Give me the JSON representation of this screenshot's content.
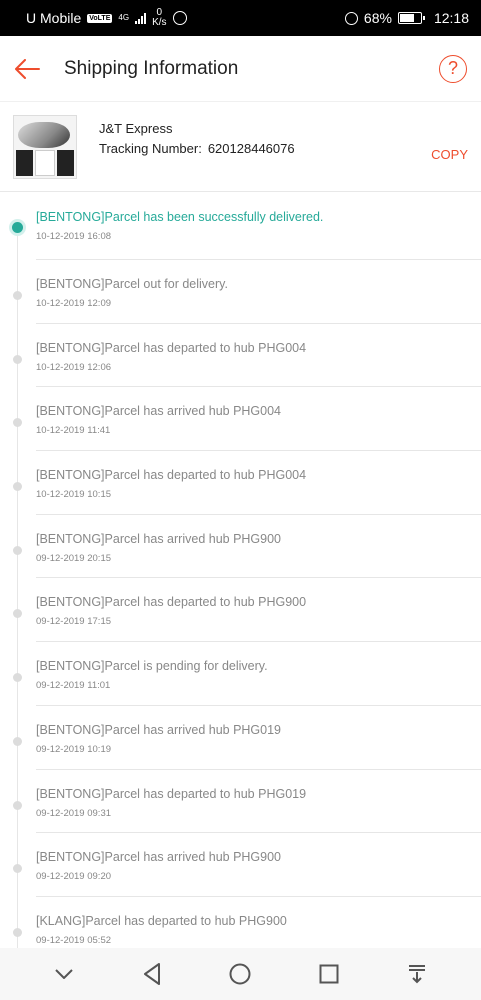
{
  "status_bar": {
    "carrier": "U Mobile",
    "volte": "VoLTE",
    "network": "4G",
    "speed_value": "0",
    "speed_unit": "K/s",
    "battery": "68%",
    "time": "12:18"
  },
  "header": {
    "title": "Shipping Information"
  },
  "carrier": {
    "name": "J&T Express",
    "tracking_label": "Tracking Number:",
    "tracking_number": "620128446076",
    "copy_label": "COPY"
  },
  "events": [
    {
      "text": "[BENTONG]Parcel has been successfully delivered.",
      "time": "10-12-2019 16:08"
    },
    {
      "text": "[BENTONG]Parcel out for delivery.",
      "time": "10-12-2019 12:09"
    },
    {
      "text": "[BENTONG]Parcel has departed to hub PHG004",
      "time": "10-12-2019 12:06"
    },
    {
      "text": "[BENTONG]Parcel has arrived hub PHG004",
      "time": "10-12-2019 11:41"
    },
    {
      "text": "[BENTONG]Parcel has departed to hub PHG004",
      "time": "10-12-2019 10:15"
    },
    {
      "text": "[BENTONG]Parcel has arrived hub PHG900",
      "time": "09-12-2019 20:15"
    },
    {
      "text": "[BENTONG]Parcel has departed to hub PHG900",
      "time": "09-12-2019 17:15"
    },
    {
      "text": "[BENTONG]Parcel is pending for delivery.",
      "time": "09-12-2019 11:01"
    },
    {
      "text": "[BENTONG]Parcel has arrived hub PHG019",
      "time": "09-12-2019 10:19"
    },
    {
      "text": "[BENTONG]Parcel has departed to hub PHG019",
      "time": "09-12-2019 09:31"
    },
    {
      "text": "[BENTONG]Parcel has arrived hub PHG900",
      "time": "09-12-2019 09:20"
    },
    {
      "text": "[KLANG]Parcel has departed to hub PHG900",
      "time": "09-12-2019 05:52"
    }
  ],
  "colors": {
    "accent": "#ee4d2d",
    "delivered": "#26aa99"
  }
}
